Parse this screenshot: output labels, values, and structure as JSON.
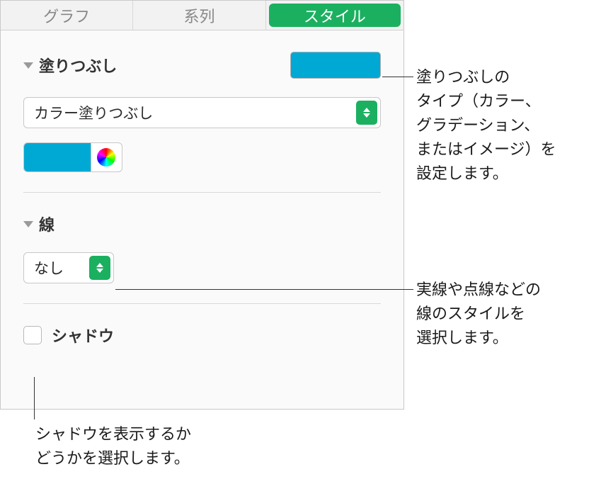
{
  "tabs": {
    "graph": "グラフ",
    "series": "系列",
    "style": "スタイル"
  },
  "fill": {
    "title": "塗りつぶし",
    "type_selected": "カラー塗りつぶし",
    "swatch_color": "#00a9d4"
  },
  "stroke": {
    "title": "線",
    "selected": "なし"
  },
  "shadow": {
    "label": "シャドウ",
    "checked": false
  },
  "callouts": {
    "fill": "塗りつぶしの\nタイプ（カラー、\nグラデーション、\nまたはイメージ）を\n設定します。",
    "stroke": "実線や点線などの\n線のスタイルを\n選択します。",
    "shadow": "シャドウを表示するか\nどうかを選択します。"
  }
}
